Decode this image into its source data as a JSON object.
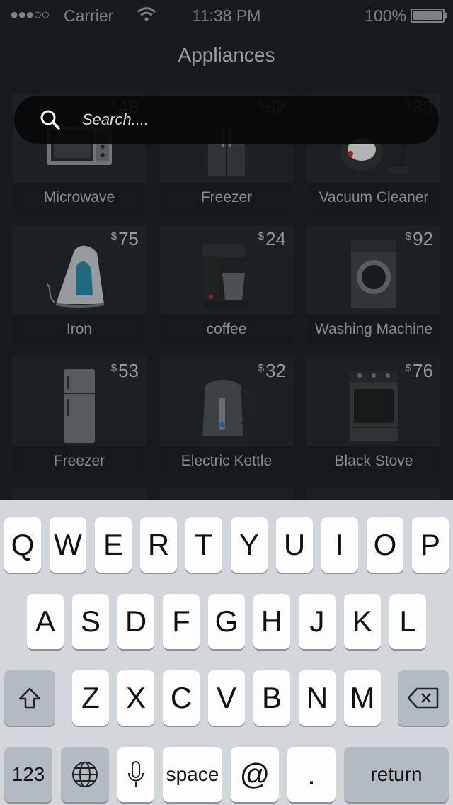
{
  "status_bar": {
    "signal": "●●●○○",
    "carrier": "Carrier",
    "time": "11:38 PM",
    "battery": "100%",
    "battery_level": 1.0
  },
  "nav": {
    "title": "Appliances"
  },
  "search": {
    "placeholder": "Search...."
  },
  "products": [
    {
      "name": "Microwave",
      "currency": "$",
      "price": "48",
      "icon": "microwave-icon"
    },
    {
      "name": "Freezer",
      "currency": "$",
      "price": "62",
      "icon": "fridge-icon"
    },
    {
      "name": "Vacuum Cleaner",
      "currency": "$",
      "price": "89",
      "icon": "vacuum-icon"
    },
    {
      "name": "Iron",
      "currency": "$",
      "price": "75",
      "icon": "iron-icon"
    },
    {
      "name": "coffee",
      "currency": "$",
      "price": "24",
      "icon": "coffee-maker-icon"
    },
    {
      "name": "Washing Machine",
      "currency": "$",
      "price": "92",
      "icon": "washing-machine-icon"
    },
    {
      "name": "Freezer",
      "currency": "$",
      "price": "53",
      "icon": "fridge-icon"
    },
    {
      "name": "Electric Kettle",
      "currency": "$",
      "price": "32",
      "icon": "kettle-icon"
    },
    {
      "name": "Black Stove",
      "currency": "$",
      "price": "76",
      "icon": "stove-icon"
    }
  ],
  "keyboard": {
    "row1": [
      "Q",
      "W",
      "E",
      "R",
      "T",
      "Y",
      "U",
      "I",
      "O",
      "P"
    ],
    "row2": [
      "A",
      "S",
      "D",
      "F",
      "G",
      "H",
      "J",
      "K",
      "L"
    ],
    "row3": [
      "Z",
      "X",
      "C",
      "V",
      "B",
      "N",
      "M"
    ],
    "numbers_label": "123",
    "space_label": "space",
    "at_label": "@",
    "period_label": ".",
    "return_label": "return"
  },
  "colors": {
    "background": "#1c2124",
    "card": "#22282b",
    "keyboard": "#d3d7dc"
  }
}
